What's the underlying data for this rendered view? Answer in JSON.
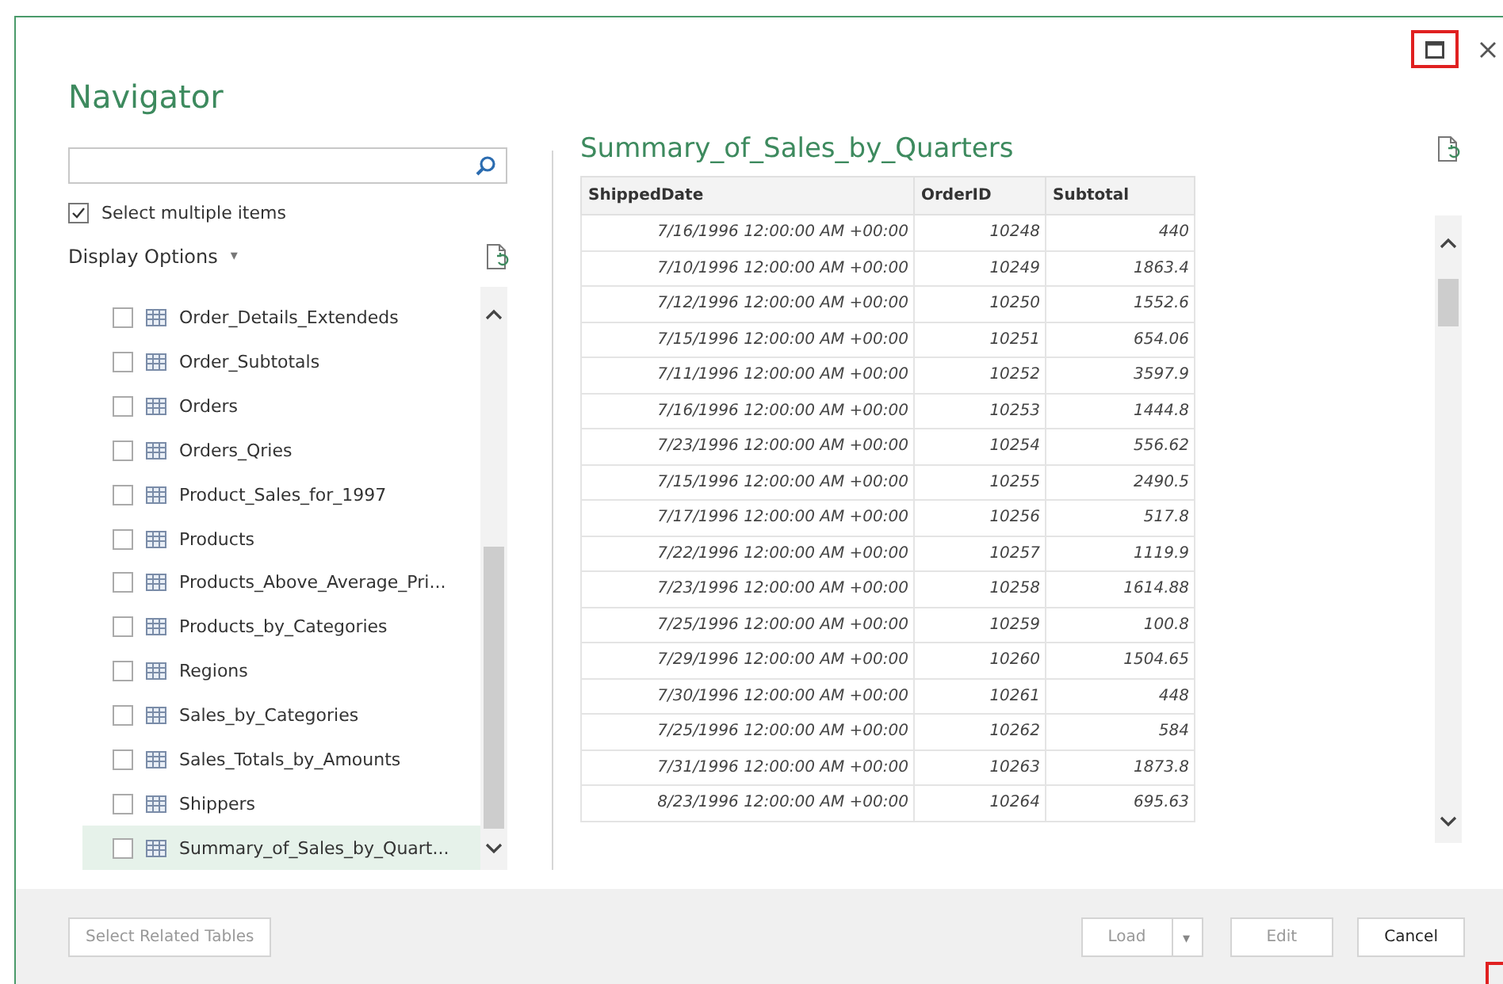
{
  "window": {
    "title": "Navigator",
    "maximize_highlighted": true
  },
  "select_multiple": {
    "label": "Select multiple items",
    "checked": true
  },
  "display_options": {
    "label": "Display Options",
    "caret": "▾"
  },
  "items": [
    {
      "label": "Order_Details_Extendeds",
      "checked": false,
      "selected": false
    },
    {
      "label": "Order_Subtotals",
      "checked": false,
      "selected": false
    },
    {
      "label": "Orders",
      "checked": false,
      "selected": false
    },
    {
      "label": "Orders_Qries",
      "checked": false,
      "selected": false
    },
    {
      "label": "Product_Sales_for_1997",
      "checked": false,
      "selected": false
    },
    {
      "label": "Products",
      "checked": false,
      "selected": false
    },
    {
      "label": "Products_Above_Average_Pri...",
      "checked": false,
      "selected": false
    },
    {
      "label": "Products_by_Categories",
      "checked": false,
      "selected": false
    },
    {
      "label": "Regions",
      "checked": false,
      "selected": false
    },
    {
      "label": "Sales_by_Categories",
      "checked": false,
      "selected": false
    },
    {
      "label": "Sales_Totals_by_Amounts",
      "checked": false,
      "selected": false
    },
    {
      "label": "Shippers",
      "checked": false,
      "selected": false
    },
    {
      "label": "Summary_of_Sales_by_Quart...",
      "checked": false,
      "selected": true
    }
  ],
  "preview": {
    "title": "Summary_of_Sales_by_Quarters",
    "columns": [
      "ShippedDate",
      "OrderID",
      "Subtotal"
    ],
    "rows": [
      [
        "7/16/1996 12:00:00 AM +00:00",
        "10248",
        "440"
      ],
      [
        "7/10/1996 12:00:00 AM +00:00",
        "10249",
        "1863.4"
      ],
      [
        "7/12/1996 12:00:00 AM +00:00",
        "10250",
        "1552.6"
      ],
      [
        "7/15/1996 12:00:00 AM +00:00",
        "10251",
        "654.06"
      ],
      [
        "7/11/1996 12:00:00 AM +00:00",
        "10252",
        "3597.9"
      ],
      [
        "7/16/1996 12:00:00 AM +00:00",
        "10253",
        "1444.8"
      ],
      [
        "7/23/1996 12:00:00 AM +00:00",
        "10254",
        "556.62"
      ],
      [
        "7/15/1996 12:00:00 AM +00:00",
        "10255",
        "2490.5"
      ],
      [
        "7/17/1996 12:00:00 AM +00:00",
        "10256",
        "517.8"
      ],
      [
        "7/22/1996 12:00:00 AM +00:00",
        "10257",
        "1119.9"
      ],
      [
        "7/23/1996 12:00:00 AM +00:00",
        "10258",
        "1614.88"
      ],
      [
        "7/25/1996 12:00:00 AM +00:00",
        "10259",
        "100.8"
      ],
      [
        "7/29/1996 12:00:00 AM +00:00",
        "10260",
        "1504.65"
      ],
      [
        "7/30/1996 12:00:00 AM +00:00",
        "10261",
        "448"
      ],
      [
        "7/25/1996 12:00:00 AM +00:00",
        "10262",
        "584"
      ],
      [
        "7/31/1996 12:00:00 AM +00:00",
        "10263",
        "1873.8"
      ],
      [
        "8/23/1996 12:00:00 AM +00:00",
        "10264",
        "695.63"
      ]
    ]
  },
  "footer": {
    "related": {
      "label": "Select Related Tables",
      "disabled": true
    },
    "load": {
      "label": "Load",
      "disabled": true,
      "caret": "▾"
    },
    "edit": {
      "label": "Edit",
      "disabled": true
    },
    "cancel": {
      "label": "Cancel",
      "disabled": false
    }
  }
}
